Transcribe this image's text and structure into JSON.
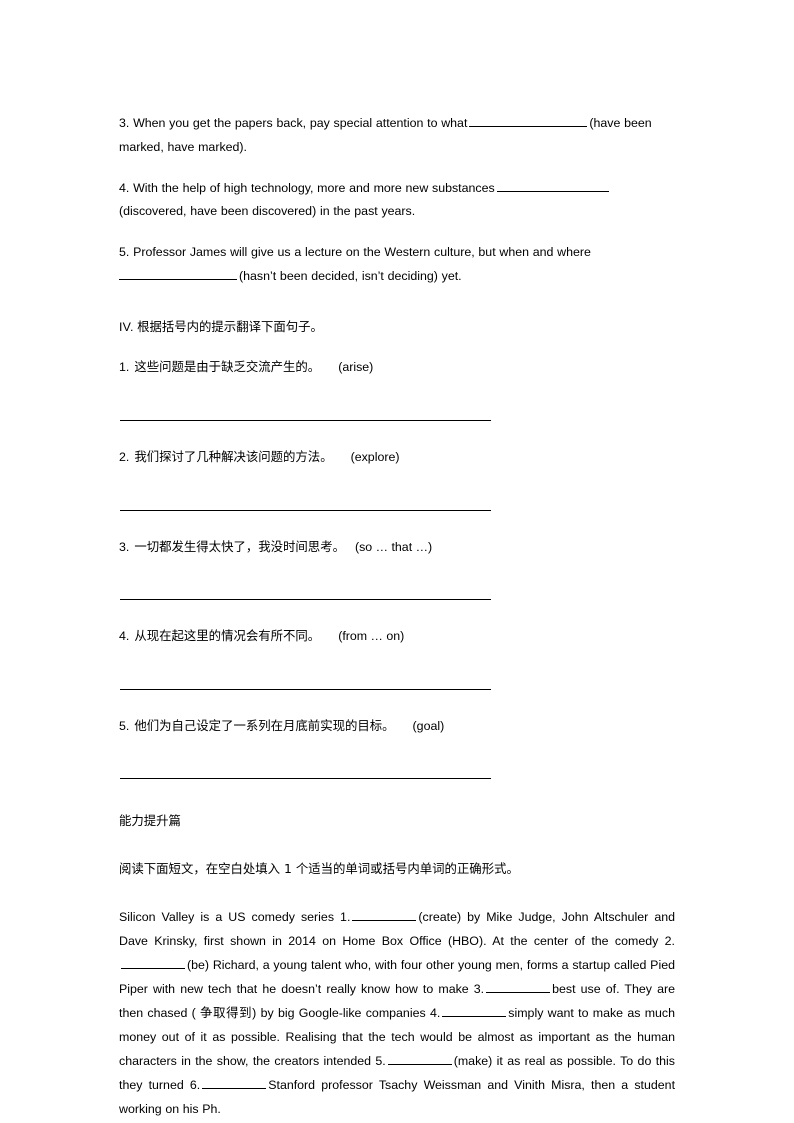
{
  "page": {
    "background": "#ffffff",
    "text_color": "#000000"
  },
  "grammar_exercises": {
    "items": [
      {
        "number": "3.",
        "text_before": "When you get the papers back, pay special attention to what",
        "blank": "",
        "text_after": "(have been marked, have marked)."
      },
      {
        "number": "4.",
        "text_before": "With the help of high technology, more and more new substances",
        "blank": "",
        "text_after": "(discovered, have been discovered) in the past years."
      },
      {
        "number": "5.",
        "text_before": "Professor James will give us a lecture on the Western culture, but when and where",
        "blank": "",
        "text_after": "(hasn’t been decided, isn’t deciding) yet."
      }
    ],
    "item3_line1": "3. When you get the papers back, pay special attention to what",
    "item3_tail": "(have been",
    "item3_line2": "marked, have marked).",
    "item4_line1": "4. With the help of high technology, more and more new substances",
    "item4_line2": "(discovered, have been discovered) in the past years.",
    "item5_line1": "5. Professor James will give us a lecture on the Western culture, but when and where",
    "item5_line2": "(hasn’t been decided, isn’t deciding) yet."
  },
  "translation_section": {
    "heading_numeral": "IV.",
    "heading_text": "根据括号内的提示翻译下面句子。",
    "items": [
      {
        "number": "1.",
        "chinese": "这些问题是由于缺乏交流产生的。",
        "hint": "(arise)"
      },
      {
        "number": "2.",
        "chinese": "我们探讨了几种解决该问题的方法。",
        "hint": "(explore)"
      },
      {
        "number": "3.",
        "chinese": "一切都发生得太快了，我没时间思考。",
        "hint": "(so … that …)"
      },
      {
        "number": "4.",
        "chinese": "从现在起这里的情况会有所不同。",
        "hint": "(from … on)"
      },
      {
        "number": "5.",
        "chinese": "他们为自己设定了一系列在月底前实现的目标。",
        "hint": "(goal)"
      }
    ]
  },
  "capability_section": {
    "heading": "能力提升篇",
    "instruction": "阅读下面短文，在空白处填入 1 个适当的单词或括号内单词的正确形式。",
    "passage": {
      "seg1": "Silicon Valley is a US comedy series 1.",
      "seg2": "(create) by Mike Judge, John Altschuler and Dave Krinsky, first shown in 2014 on Home Box Office (HBO). At the center of the comedy 2.",
      "seg3": "(be) Richard, a young talent who, with four other young men, forms a startup called Pied Piper with new tech that he doesn’t really know how to make 3.",
      "seg4": "best use of. They are then chased ( 争取得到) by big Google-like companies 4.",
      "seg5": "simply want to make as much money out of it as possible. Realising that the tech would be almost as important as the human characters in the show, the creators intended 5.",
      "seg6": "(make) it as real as possible.  To do this they turned 6.",
      "seg7": "Stanford professor Tsachy Weissman and Vinith Misra, then a student working on his Ph."
    }
  }
}
